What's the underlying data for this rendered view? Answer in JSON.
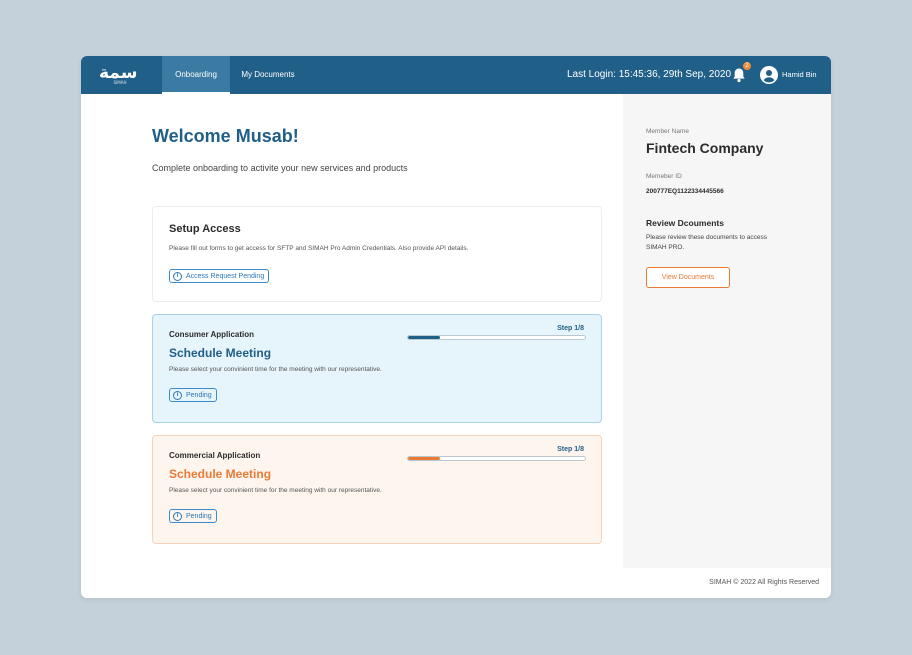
{
  "header": {
    "logo_text": "سمة",
    "logo_sub": "SIMAH",
    "tabs": [
      {
        "label": "Onboarding",
        "active": true
      },
      {
        "label": "My Documents",
        "active": false
      }
    ],
    "last_login": "Last Login: 15:45:36, 29th Sep, 2020",
    "notification_count": "2",
    "user_name": "Hamid Bin",
    "icons": {
      "bell": "bell-icon",
      "avatar": "user-avatar-icon"
    },
    "colors": {
      "bar": "#1f5f88",
      "badge": "#f08a3c"
    }
  },
  "main": {
    "welcome": "Welcome Musab!",
    "subtitle": "Complete onboarding to activite your new services and products",
    "setup": {
      "title": "Setup Access",
      "desc": "Please fill out forms to get access for SFTP and SIMAH Pro Admin Credentials. Also provide API details.",
      "status": "Access Request Pending"
    },
    "consumer": {
      "label": "Consumer Application",
      "heading": "Schedule Meeting",
      "desc": "Please select your convinient time for the meeting with our representative.",
      "status": "Pending",
      "step": "Step 1/8",
      "progress": 0.18,
      "accent": "#1f5f88"
    },
    "commercial": {
      "label": "Commercial Application",
      "heading": "Schedule Meeting",
      "desc": "Please select your convinient time for the meeting with our representative.",
      "status": "Pending",
      "step": "Step 1/8",
      "progress": 0.18,
      "accent": "#e97a35"
    }
  },
  "sidebar": {
    "member_name_label": "Member Name",
    "member_name": "Fintech Company",
    "member_id_label": "Memeber ID",
    "member_id": "200777EQ1122334445566",
    "review_title": "Review Dcouments",
    "review_desc": "Please review these documents to access SIMAH PRO.",
    "view_button": "View Documents"
  },
  "footer": {
    "text": "SIMAH © 2022 All Rights Reserved"
  }
}
